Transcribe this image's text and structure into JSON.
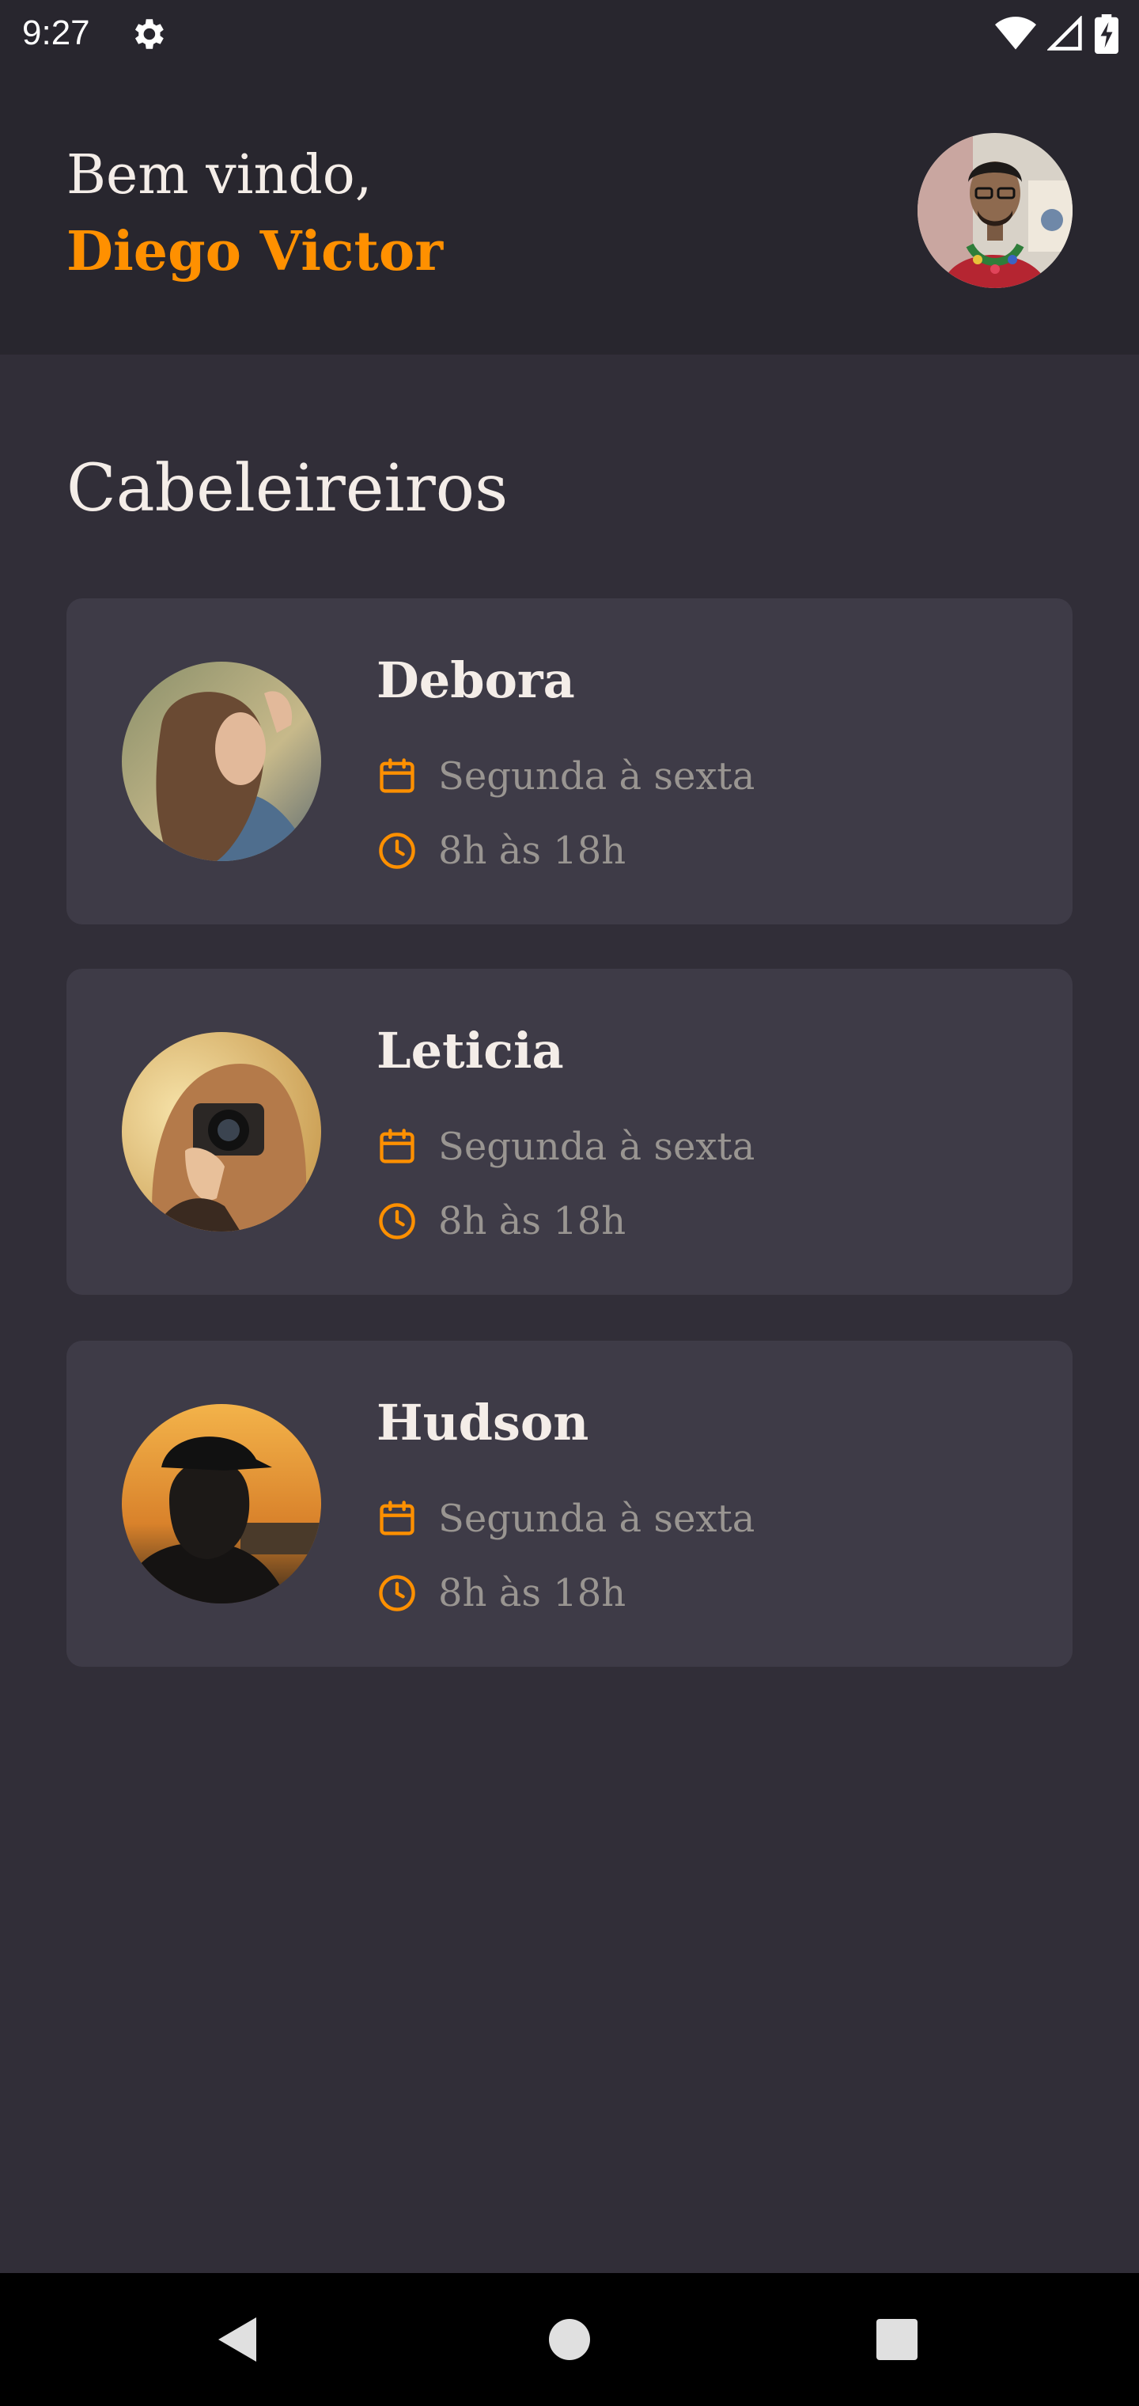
{
  "status_bar": {
    "time": "9:27",
    "icons": [
      "gear-icon",
      "wifi-icon",
      "signal-icon",
      "battery-charging-icon"
    ]
  },
  "header": {
    "greeting": "Bem vindo,",
    "user_name": "Diego Victor",
    "avatar": "profile-photo"
  },
  "section": {
    "title": "Cabeleireiros"
  },
  "providers": [
    {
      "name": "Debora",
      "days": "Segunda à sexta",
      "hours": "8h às 18h",
      "avatar": "debora-photo"
    },
    {
      "name": "Leticia",
      "days": "Segunda à sexta",
      "hours": "8h às 18h",
      "avatar": "leticia-photo"
    },
    {
      "name": "Hudson",
      "days": "Segunda à sexta",
      "hours": "8h às 18h",
      "avatar": "hudson-photo"
    }
  ],
  "nav": {
    "icons": [
      "back-icon",
      "home-icon",
      "recents-icon"
    ]
  },
  "colors": {
    "background": "#312e38",
    "header": "#28262e",
    "card": "#3e3b47",
    "accent": "#ff9000",
    "text": "#f4ede8",
    "muted": "#999591"
  }
}
